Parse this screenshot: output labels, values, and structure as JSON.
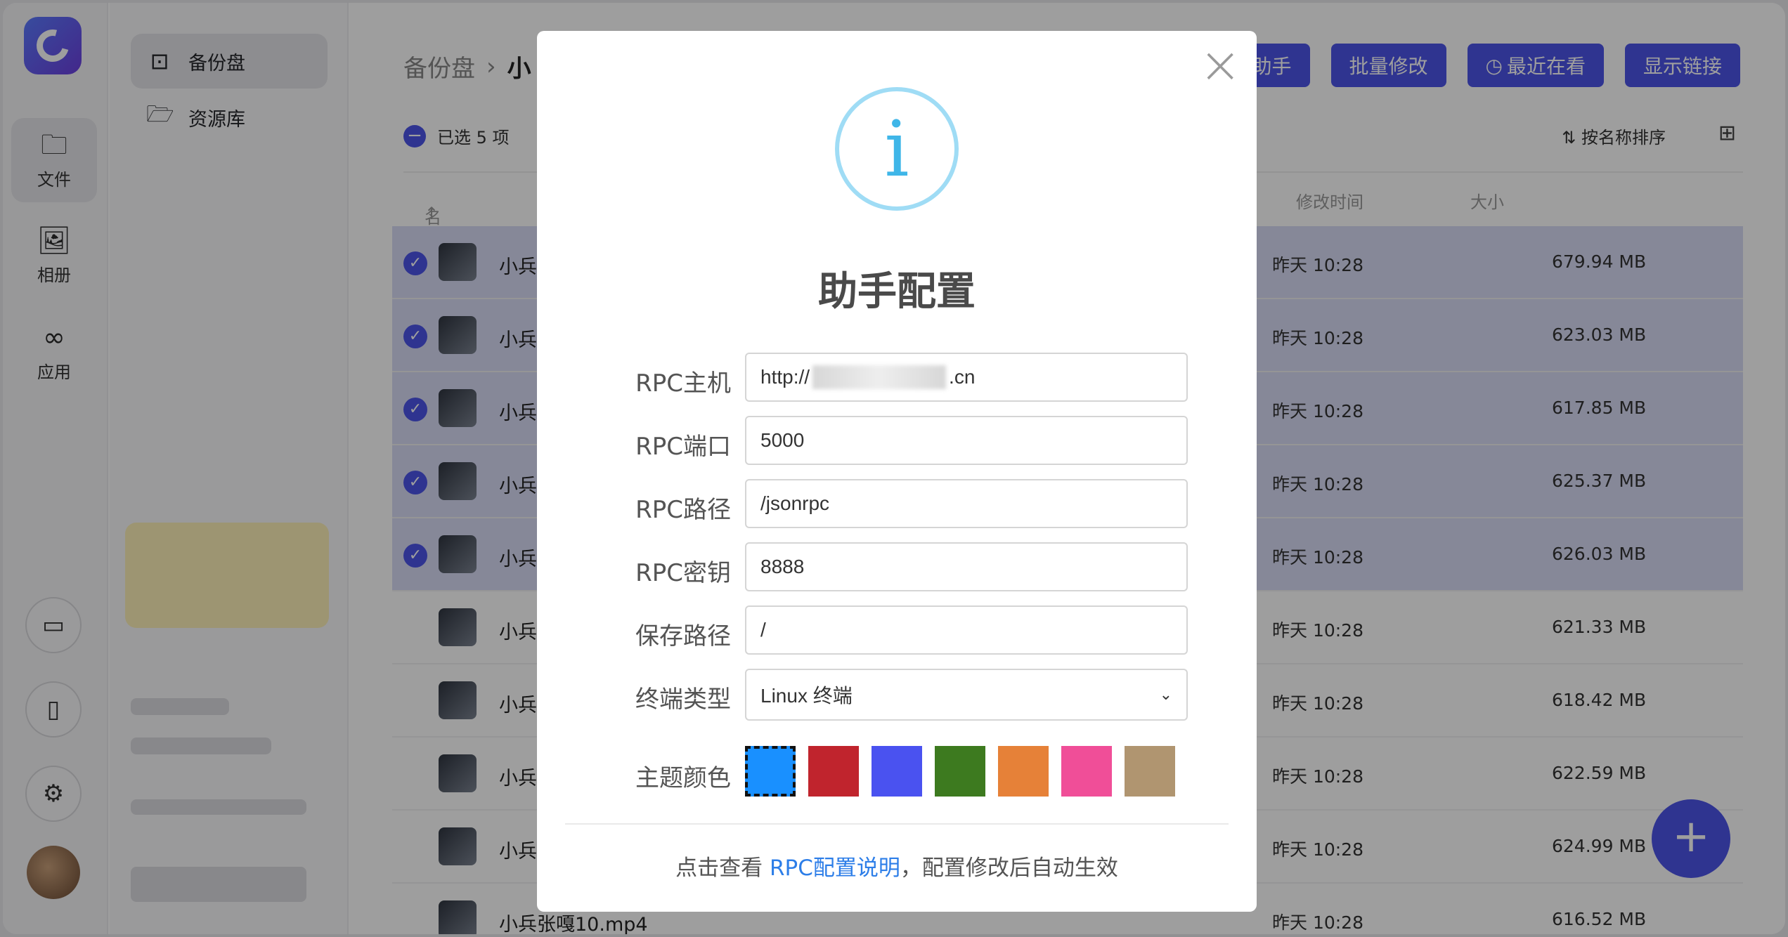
{
  "rail": {
    "items": [
      {
        "label": "文件",
        "icon": "folder-icon"
      },
      {
        "label": "相册",
        "icon": "photo-icon"
      },
      {
        "label": "应用",
        "icon": "apps-icon"
      }
    ],
    "bottom_icons": [
      "laptop-icon",
      "phone-icon",
      "settings-icon"
    ]
  },
  "sidebar": {
    "items": [
      {
        "label": "备份盘",
        "icon": "backup-disk-icon"
      },
      {
        "label": "资源库",
        "icon": "library-folder-icon"
      }
    ]
  },
  "main": {
    "breadcrumb": {
      "root": "备份盘",
      "sep": "›",
      "current": "小"
    },
    "buttons": {
      "helper": "助手",
      "batch": "批量修改",
      "recent": "最近在看",
      "show_links": "显示链接"
    },
    "selection": "已选 5 项",
    "sort_label": "按名称排序",
    "columns": {
      "name": "名称",
      "name_arrow": "↑",
      "mtime": "修改时间",
      "size": "大小"
    },
    "rows": [
      {
        "name": "小兵",
        "time": "昨天 10:28",
        "size": "679.94 MB",
        "selected": true
      },
      {
        "name": "小兵",
        "time": "昨天 10:28",
        "size": "623.03 MB",
        "selected": true
      },
      {
        "name": "小兵",
        "time": "昨天 10:28",
        "size": "617.85 MB",
        "selected": true
      },
      {
        "name": "小兵",
        "time": "昨天 10:28",
        "size": "625.37 MB",
        "selected": true
      },
      {
        "name": "小兵",
        "time": "昨天 10:28",
        "size": "626.03 MB",
        "selected": true
      },
      {
        "name": "小兵",
        "time": "昨天 10:28",
        "size": "621.33 MB",
        "selected": false
      },
      {
        "name": "小兵",
        "time": "昨天 10:28",
        "size": "618.42 MB",
        "selected": false
      },
      {
        "name": "小兵",
        "time": "昨天 10:28",
        "size": "622.59 MB",
        "selected": false
      },
      {
        "name": "小兵",
        "time": "昨天 10:28",
        "size": "624.99 MB",
        "selected": false
      },
      {
        "name": "小兵张嘎10.mp4",
        "time": "昨天 10:28",
        "size": "616.52 MB",
        "selected": false
      }
    ],
    "fab": "+"
  },
  "modal": {
    "title": "助手配置",
    "close": "×",
    "fields": {
      "host": {
        "label": "RPC主机",
        "prefix": "http://",
        "suffix": ".cn"
      },
      "port": {
        "label": "RPC端口",
        "value": "5000"
      },
      "path": {
        "label": "RPC路径",
        "value": "/jsonrpc"
      },
      "secret": {
        "label": "RPC密钥",
        "value": "8888"
      },
      "save_path": {
        "label": "保存路径",
        "value": "/"
      },
      "terminal": {
        "label": "终端类型",
        "value": "Linux 终端"
      }
    },
    "theme_label": "主题颜色",
    "theme_colors": [
      "#1990ff",
      "#c0242d",
      "#4a52f0",
      "#3d7a1f",
      "#e68138",
      "#f04e98",
      "#b09570"
    ],
    "footer": {
      "before": "点击查看 ",
      "link": "RPC配置说明",
      "after": "，配置修改后自动生效"
    }
  }
}
